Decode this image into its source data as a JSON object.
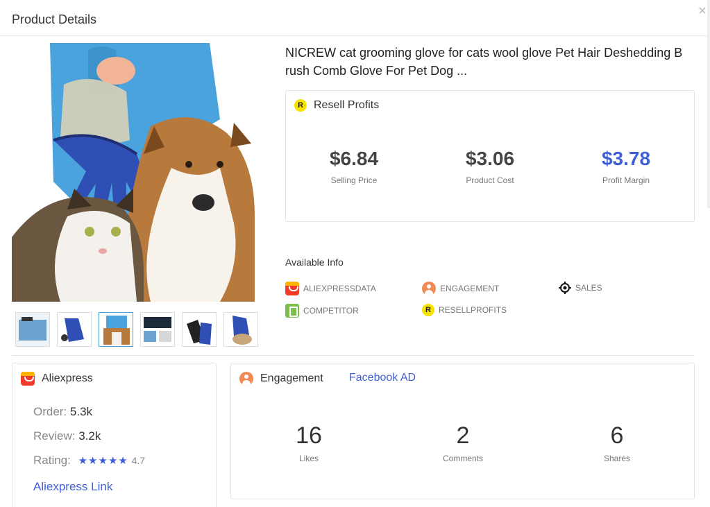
{
  "header": {
    "title": "Product Details"
  },
  "product": {
    "title": "NICREW cat grooming glove for cats wool glove Pet Hair Deshedding B rush Comb Glove For Pet Dog ..."
  },
  "resell": {
    "heading": "Resell Profits",
    "icon_letter": "R",
    "selling_price": "$6.84",
    "selling_price_label": "Selling Price",
    "product_cost": "$3.06",
    "product_cost_label": "Product Cost",
    "profit_margin": "$3.78",
    "profit_margin_label": "Profit Margin"
  },
  "available": {
    "title": "Available Info",
    "items": [
      {
        "label": "ALIEXPRESSDATA",
        "icon": "aliexpress-icon"
      },
      {
        "label": "ENGAGEMENT",
        "icon": "engagement-icon"
      },
      {
        "label": "SALES",
        "icon": "target-icon"
      },
      {
        "label": "COMPETITOR",
        "icon": "shopify-bag-icon"
      },
      {
        "label": "RESELLPROFITS",
        "icon": "resell-icon",
        "letter": "R"
      }
    ]
  },
  "aliexpress": {
    "heading": "Aliexpress",
    "order_label": "Order:",
    "order_value": "5.3k",
    "review_label": "Review:",
    "review_value": "3.2k",
    "rating_label": "Rating:",
    "stars": "★★★★★",
    "rating_value": "4.7",
    "link": "Aliexpress Link"
  },
  "engagement": {
    "heading": "Engagement",
    "facebook_link": "Facebook AD",
    "likes": "16",
    "likes_label": "Likes",
    "comments": "2",
    "comments_label": "Comments",
    "shares": "6",
    "shares_label": "Shares"
  },
  "colors": {
    "accent_blue": "#3f5fd6",
    "resell_yellow": "#f7e300",
    "aliexpress_red": "#f23a2a",
    "engagement_orange": "#f08a55",
    "competitor_green": "#7cc04b"
  }
}
